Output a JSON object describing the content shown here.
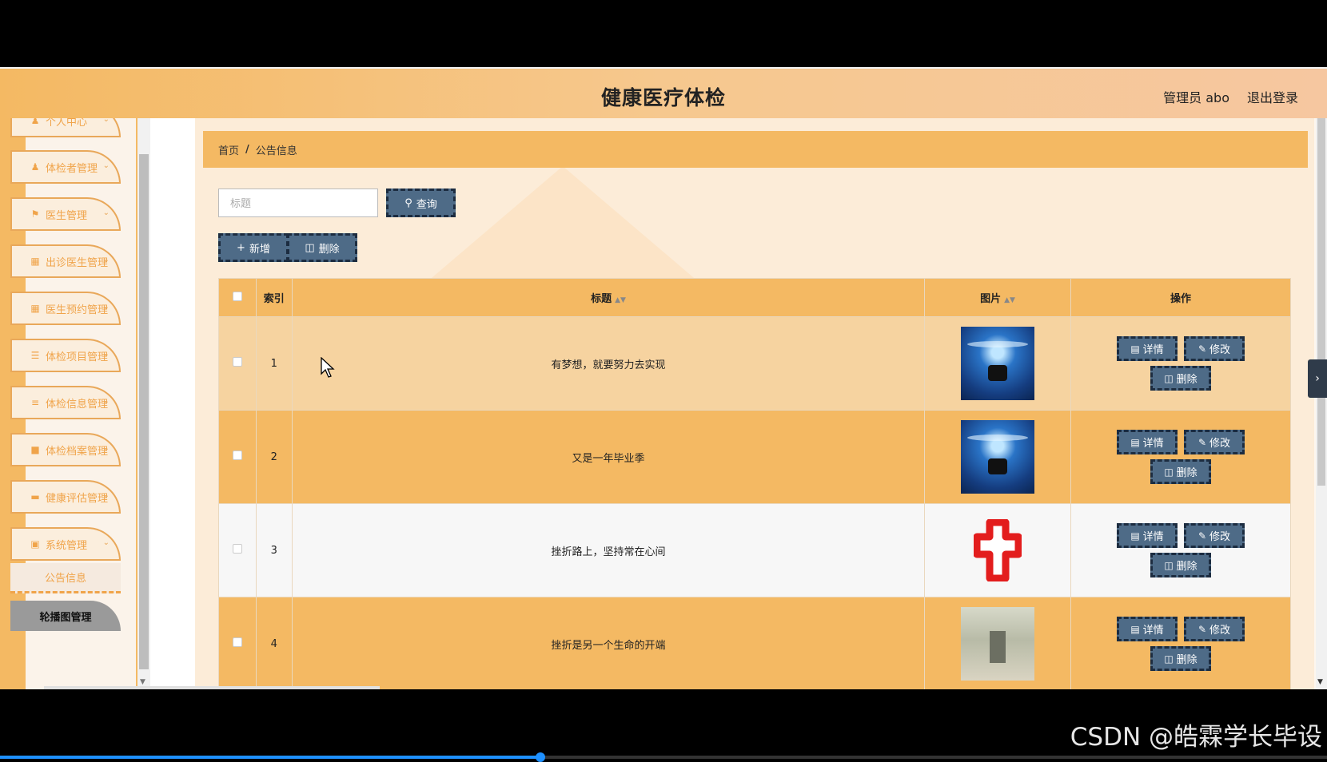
{
  "header": {
    "title": "健康医疗体检",
    "user": "管理员 abo",
    "logout": "退出登录"
  },
  "sidebar": {
    "items": [
      {
        "label": "个人中心",
        "icon": "user-icon"
      },
      {
        "label": "体检者管理",
        "icon": "user-icon"
      },
      {
        "label": "医生管理",
        "icon": "flag-icon"
      },
      {
        "label": "出诊医生管理",
        "icon": "grid-icon"
      },
      {
        "label": "医生预约管理",
        "icon": "grid-icon"
      },
      {
        "label": "体检项目管理",
        "icon": "sliders-icon"
      },
      {
        "label": "体检信息管理",
        "icon": "list-icon"
      },
      {
        "label": "体检档案管理",
        "icon": "clipboard-icon"
      },
      {
        "label": "健康评估管理",
        "icon": "chat-icon"
      },
      {
        "label": "系统管理",
        "icon": "book-icon"
      }
    ],
    "sub_items": [
      "公告信息",
      "轮播图管理"
    ]
  },
  "breadcrumb": {
    "home": "首页",
    "separator": "/",
    "current": "公告信息"
  },
  "search": {
    "placeholder": "标题",
    "button": "查询"
  },
  "actions": {
    "add": "新增",
    "delete": "删除"
  },
  "table": {
    "columns": [
      "索引",
      "标题",
      "图片",
      "操作"
    ],
    "rows": [
      {
        "index": "1",
        "title": "有梦想，就要努力去实现",
        "image": "operating-room-photo"
      },
      {
        "index": "2",
        "title": "又是一年毕业季",
        "image": "operating-room-photo"
      },
      {
        "index": "3",
        "title": "挫折路上，坚持常在心间",
        "image": "red-cross-logo"
      },
      {
        "index": "4",
        "title": "挫折是另一个生命的开端",
        "image": "hospital-corridor-photo"
      }
    ],
    "row_actions": {
      "detail": "详情",
      "edit": "修改",
      "delete": "删除"
    }
  },
  "watermark": "CSDN @皓霖学长毕设",
  "colors": {
    "accent": "#f4b963",
    "button": "#4e6b87",
    "header_text": "#222222"
  }
}
